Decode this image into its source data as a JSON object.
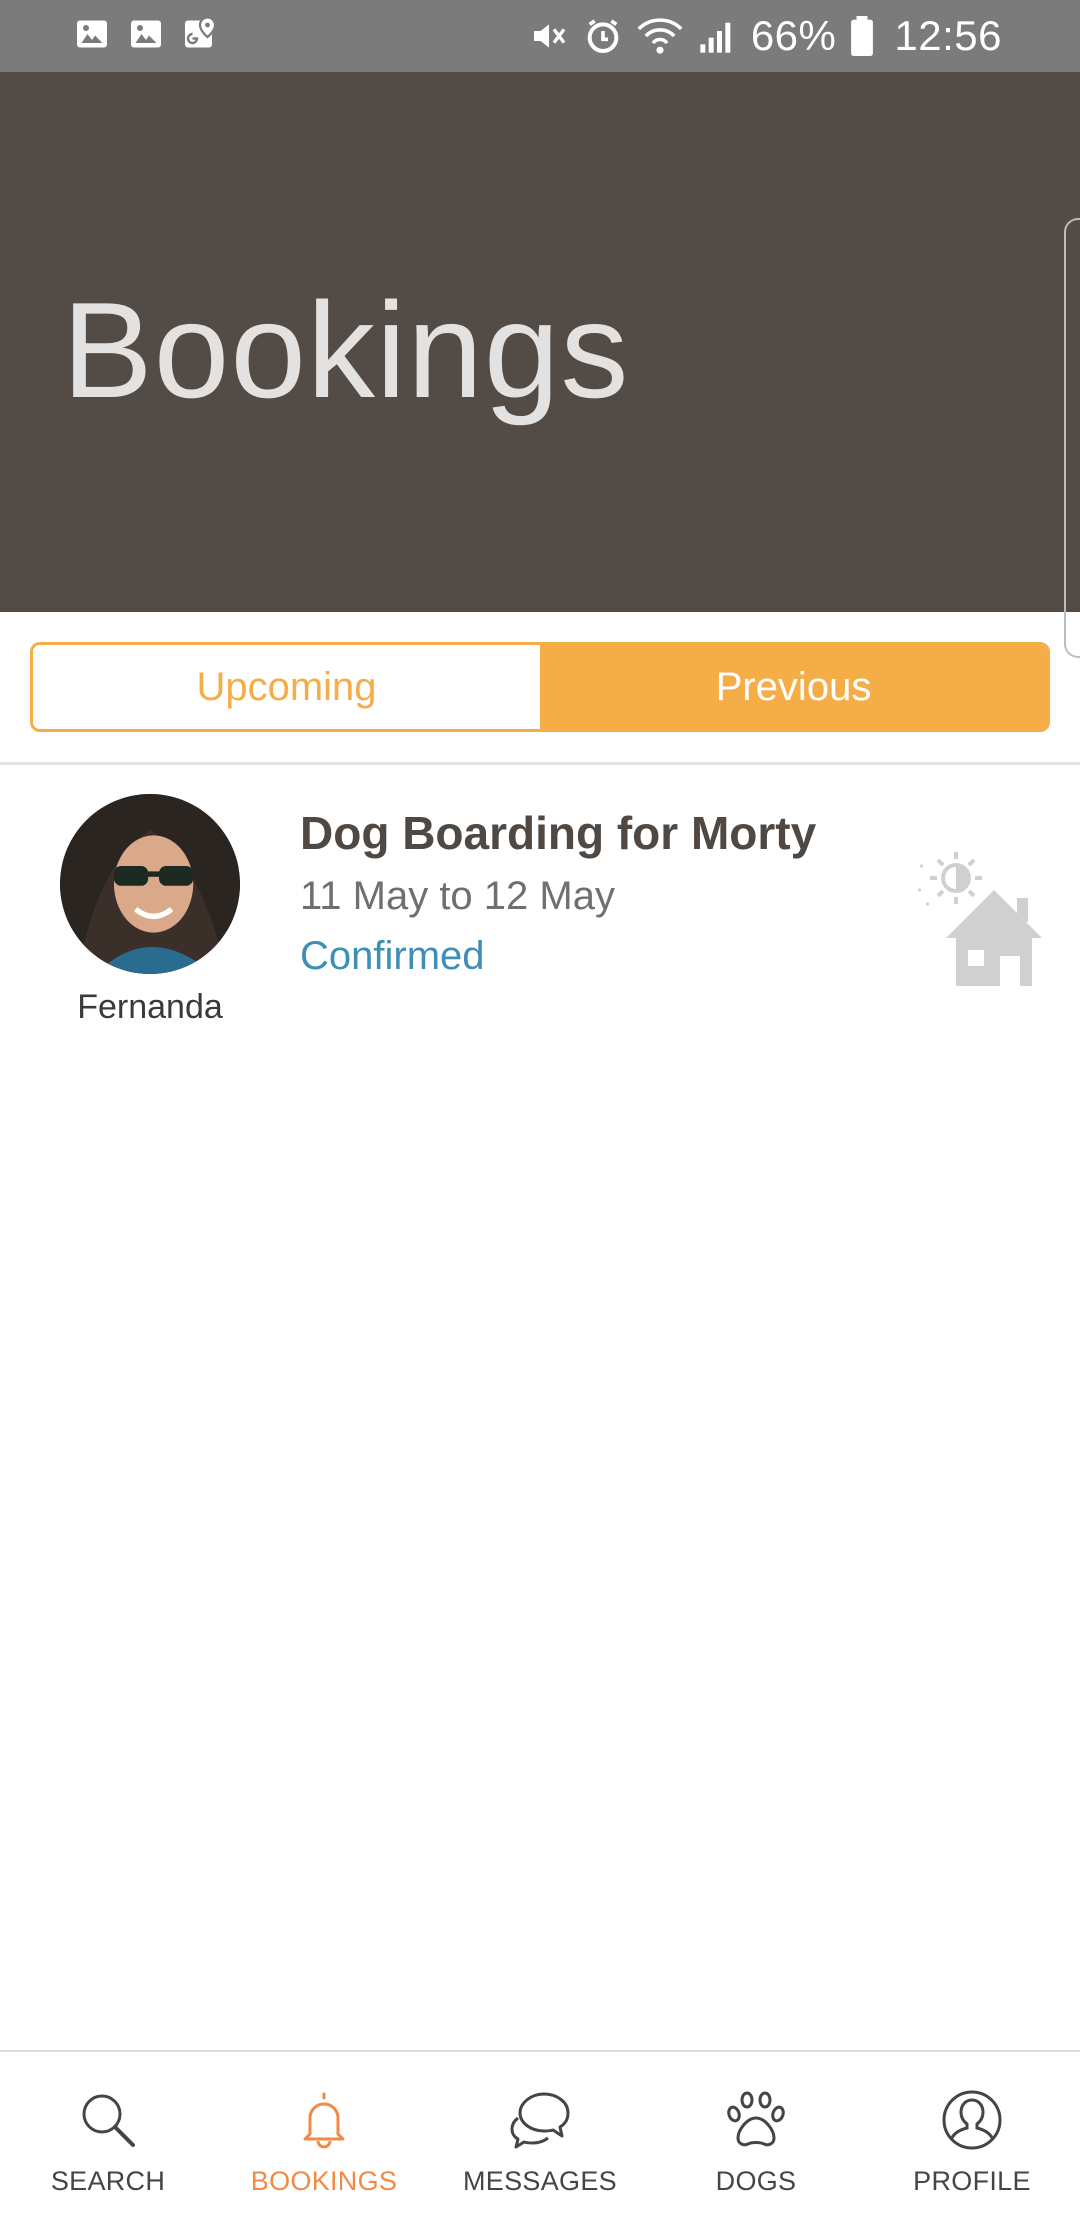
{
  "status_bar": {
    "battery": "66%",
    "time": "12:56"
  },
  "header": {
    "title": "Bookings"
  },
  "tabs": {
    "upcoming_label": "Upcoming",
    "previous_label": "Previous",
    "selected": "Previous"
  },
  "bookings": [
    {
      "sitter_name": "Fernanda",
      "title": "Dog Boarding for Morty",
      "dates": "11 May to 12 May",
      "status": "Confirmed",
      "service_icon": "boarding-house-day-night-icon"
    }
  ],
  "bottom_nav": {
    "items": [
      {
        "label": "SEARCH",
        "icon": "search-icon"
      },
      {
        "label": "BOOKINGS",
        "icon": "bell-icon"
      },
      {
        "label": "MESSAGES",
        "icon": "chat-bubbles-icon"
      },
      {
        "label": "DOGS",
        "icon": "paw-icon"
      },
      {
        "label": "PROFILE",
        "icon": "user-icon"
      }
    ],
    "active": "BOOKINGS"
  },
  "colors": {
    "header_bg": "#534b45",
    "accent_orange": "#f5ad48",
    "active_nav": "#f08a45",
    "status_blue": "#3f8eb3",
    "status_bar_bg": "#7b7b7b"
  }
}
